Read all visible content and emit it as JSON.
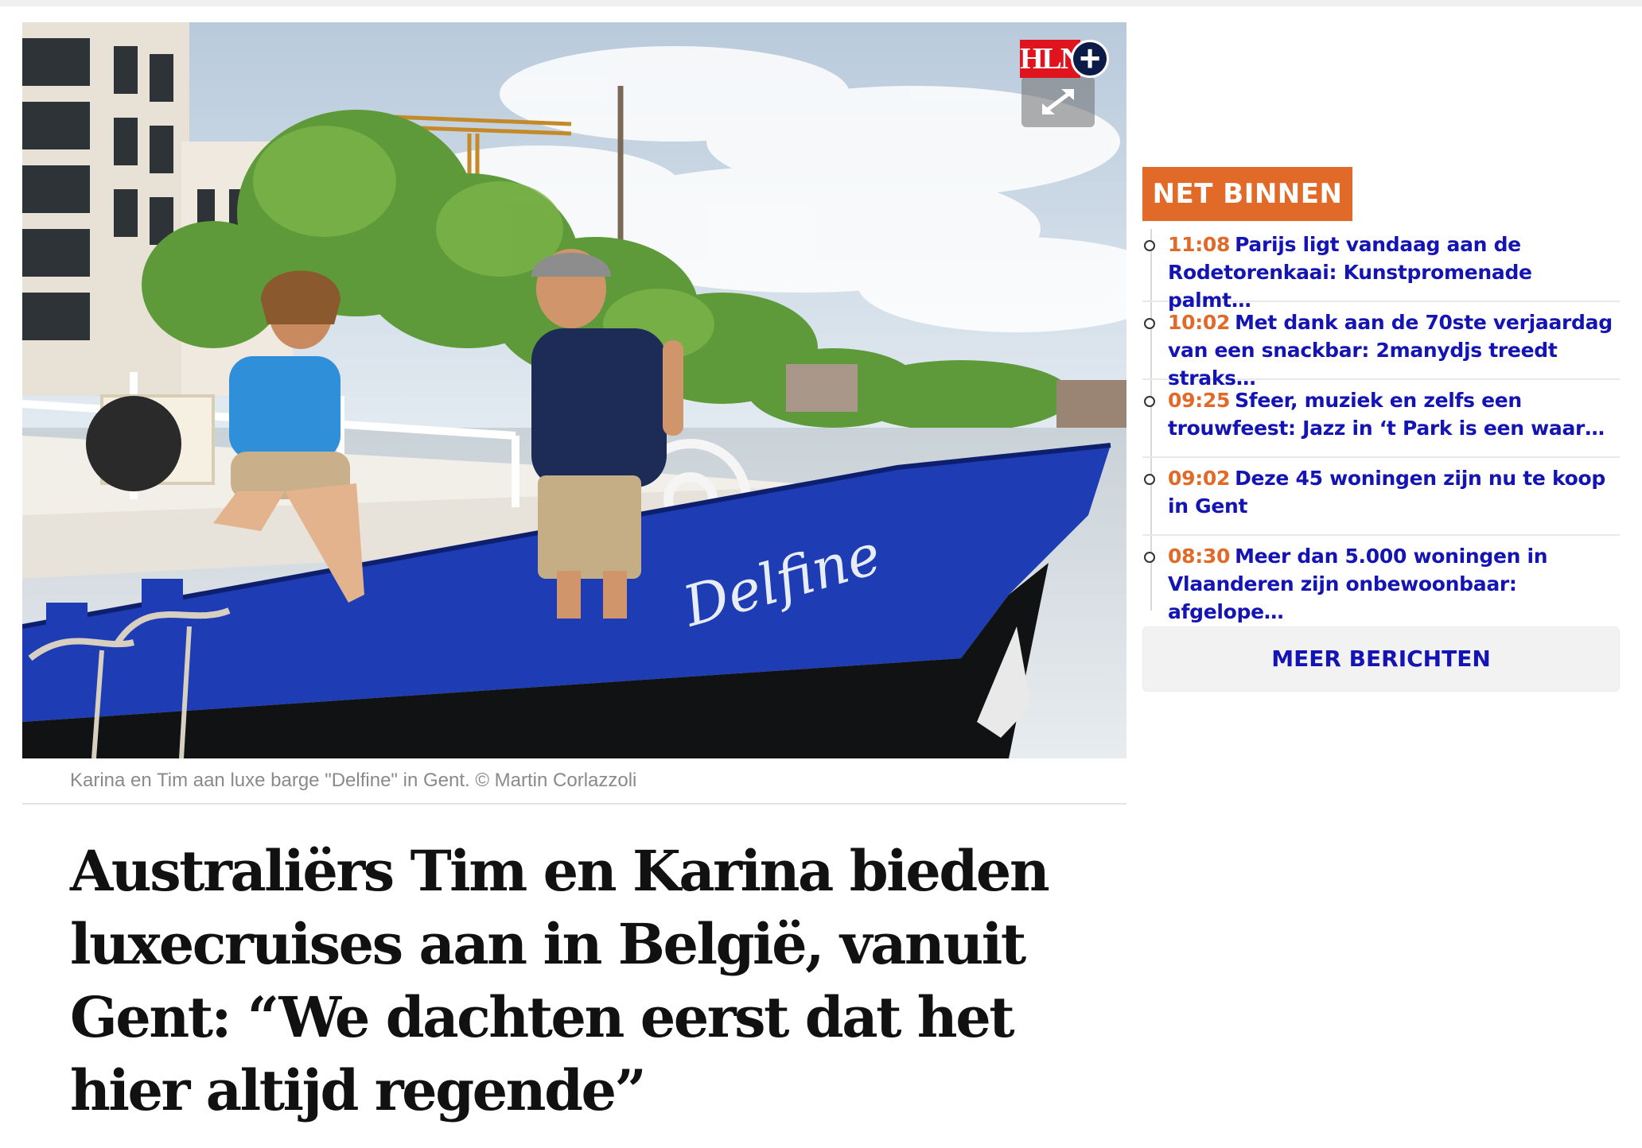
{
  "hero": {
    "boat_name": "Delfine",
    "badge_brand": "HLN",
    "badge_symbol": "+",
    "caption": "Karina en Tim aan luxe barge \"Delfine\" in Gent. © Martin Corlazzoli"
  },
  "article": {
    "headline": "Australiërs Tim en Karina bieden luxecruises aan in België, vanuit Gent: “We dachten eerst dat het hier altijd regende”"
  },
  "sidebar": {
    "heading": "NET BINNEN",
    "items": [
      {
        "time": "11:08",
        "title": "Parijs ligt vandaag aan de Rodetorenkaai: Kunstpromenade palmt…"
      },
      {
        "time": "10:02",
        "title": "Met dank aan de 70ste verjaardag van een snackbar: 2manydjs treedt straks…"
      },
      {
        "time": "09:25",
        "title": "Sfeer, muziek en zelfs een trouwfeest: Jazz in ‘t Park is een waar…"
      },
      {
        "time": "09:02",
        "title": "Deze 45 woningen zijn nu te koop in Gent"
      },
      {
        "time": "08:30",
        "title": "Meer dan 5.000 woningen in Vlaanderen zijn onbewoonbaar: afgelope…"
      }
    ],
    "more_label": "MEER BERICHTEN"
  },
  "colors": {
    "accent_orange": "#e16a28",
    "link_blue": "#1414b4",
    "hln_red": "#e0141e",
    "boat_blue": "#1e3cb4"
  }
}
